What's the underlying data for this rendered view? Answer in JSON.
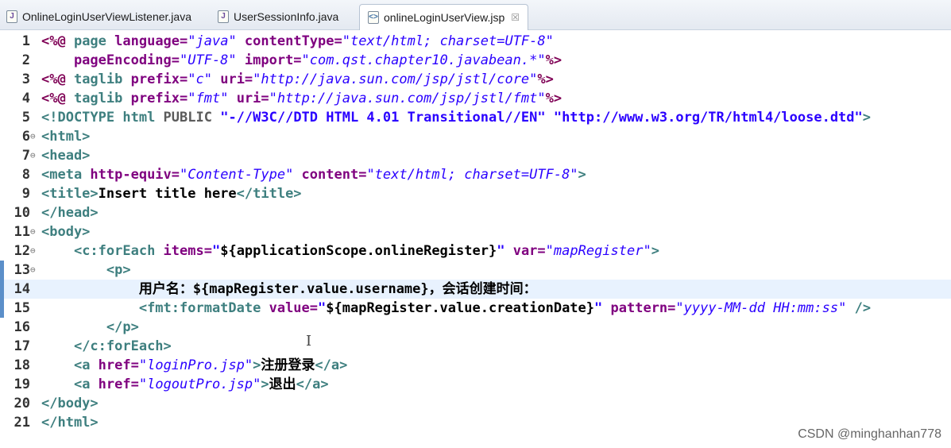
{
  "tabs": [
    {
      "label": "OnlineLoginUserViewListener.java",
      "icon": "java-file-icon"
    },
    {
      "label": "UserSessionInfo.java",
      "icon": "java-file-icon"
    },
    {
      "label": "onlineLoginUserView.jsp",
      "icon": "jsp-file-icon",
      "close": "☒"
    }
  ],
  "lines": [
    {
      "n": "1",
      "fold": "",
      "segs": [
        [
          "jk",
          "<%@ "
        ],
        [
          "tg",
          "page "
        ],
        [
          "at",
          "language="
        ],
        [
          "iv",
          "\"java\""
        ],
        [
          "at",
          " contentType="
        ],
        [
          "iv",
          "\"text/html; charset=UTF-8\""
        ]
      ]
    },
    {
      "n": "2",
      "fold": "",
      "segs": [
        [
          "at",
          "    pageEncoding="
        ],
        [
          "iv",
          "\"UTF-8\""
        ],
        [
          "at",
          " import="
        ],
        [
          "iv",
          "\"com.qst.chapter10.javabean.*\""
        ],
        [
          "jk",
          "%>"
        ]
      ]
    },
    {
      "n": "3",
      "fold": "",
      "segs": [
        [
          "jk",
          "<%@ "
        ],
        [
          "tg",
          "taglib "
        ],
        [
          "at",
          "prefix="
        ],
        [
          "iv",
          "\"c\""
        ],
        [
          "at",
          " uri="
        ],
        [
          "iv",
          "\"http://java.sun.com/jsp/jstl/core\""
        ],
        [
          "jk",
          "%>"
        ]
      ]
    },
    {
      "n": "4",
      "fold": "",
      "segs": [
        [
          "jk",
          "<%@ "
        ],
        [
          "tg",
          "taglib "
        ],
        [
          "at",
          "prefix="
        ],
        [
          "iv",
          "\"fmt\""
        ],
        [
          "at",
          " uri="
        ],
        [
          "iv",
          "\"http://java.sun.com/jsp/jstl/fmt\""
        ],
        [
          "jk",
          "%>"
        ]
      ]
    },
    {
      "n": "5",
      "fold": "",
      "segs": [
        [
          "tg",
          "<!DOCTYPE "
        ],
        [
          "tg",
          "html "
        ],
        [
          "dt",
          "PUBLIC "
        ],
        [
          "sv",
          "\"-//W3C//DTD HTML 4.01 Transitional//EN\" \"http://www.w3.org/TR/html4/loose.dtd\""
        ],
        [
          "tg",
          ">"
        ]
      ]
    },
    {
      "n": "6",
      "fold": "⊖",
      "segs": [
        [
          "tg",
          "<html>"
        ]
      ]
    },
    {
      "n": "7",
      "fold": "⊖",
      "segs": [
        [
          "tg",
          "<head>"
        ]
      ]
    },
    {
      "n": "8",
      "fold": "",
      "segs": [
        [
          "tg",
          "<meta "
        ],
        [
          "at",
          "http-equiv="
        ],
        [
          "iv",
          "\"Content-Type\""
        ],
        [
          "at",
          " content="
        ],
        [
          "iv",
          "\"text/html; charset=UTF-8\""
        ],
        [
          "tg",
          ">"
        ]
      ]
    },
    {
      "n": "9",
      "fold": "",
      "segs": [
        [
          "tg",
          "<title>"
        ],
        [
          "",
          "Insert title here"
        ],
        [
          "tg",
          "</title>"
        ]
      ]
    },
    {
      "n": "10",
      "fold": "",
      "segs": [
        [
          "tg",
          "</head>"
        ]
      ]
    },
    {
      "n": "11",
      "fold": "⊖",
      "segs": [
        [
          "tg",
          "<body>"
        ]
      ]
    },
    {
      "n": "12",
      "fold": "⊖",
      "segs": [
        [
          "",
          "    "
        ],
        [
          "tg",
          "<c:forEach "
        ],
        [
          "at",
          "items="
        ],
        [
          "sv",
          "\""
        ],
        [
          "",
          "${applicationScope.onlineRegister}"
        ],
        [
          "sv",
          "\""
        ],
        [
          "at",
          " var="
        ],
        [
          "iv",
          "\"mapRegister\""
        ],
        [
          "tg",
          ">"
        ]
      ]
    },
    {
      "n": "13",
      "fold": "⊖",
      "segs": [
        [
          "",
          "        "
        ],
        [
          "tg",
          "<p>"
        ]
      ]
    },
    {
      "n": "14",
      "fold": "",
      "current": true,
      "segs": [
        [
          "",
          "            用户名：${mapRegister.value.username}，会话创建时间："
        ]
      ]
    },
    {
      "n": "15",
      "fold": "",
      "segs": [
        [
          "",
          "            "
        ],
        [
          "tg",
          "<fmt:formatDate "
        ],
        [
          "at",
          "value="
        ],
        [
          "sv",
          "\""
        ],
        [
          "",
          "${mapRegister.value.creationDate}"
        ],
        [
          "sv",
          "\""
        ],
        [
          "at",
          " pattern="
        ],
        [
          "iv",
          "\"yyyy-MM-dd HH:mm:ss\""
        ],
        [
          "tg",
          " />"
        ]
      ]
    },
    {
      "n": "16",
      "fold": "",
      "segs": [
        [
          "",
          "        "
        ],
        [
          "tg",
          "</p>"
        ]
      ]
    },
    {
      "n": "17",
      "fold": "",
      "segs": [
        [
          "",
          "    "
        ],
        [
          "tg",
          "</c:forEach>"
        ]
      ]
    },
    {
      "n": "18",
      "fold": "",
      "segs": [
        [
          "",
          "    "
        ],
        [
          "tg",
          "<a "
        ],
        [
          "at",
          "href="
        ],
        [
          "iv",
          "\"loginPro.jsp\""
        ],
        [
          "tg",
          ">"
        ],
        [
          "",
          "注册登录"
        ],
        [
          "tg",
          "</a>"
        ]
      ]
    },
    {
      "n": "19",
      "fold": "",
      "segs": [
        [
          "",
          "    "
        ],
        [
          "tg",
          "<a "
        ],
        [
          "at",
          "href="
        ],
        [
          "iv",
          "\"logoutPro.jsp\""
        ],
        [
          "tg",
          ">"
        ],
        [
          "",
          "退出"
        ],
        [
          "tg",
          "</a>"
        ]
      ]
    },
    {
      "n": "20",
      "fold": "",
      "segs": [
        [
          "tg",
          "</body>"
        ]
      ]
    },
    {
      "n": "21",
      "fold": "",
      "segs": [
        [
          "tg",
          "</html>"
        ]
      ]
    }
  ],
  "cursor_glyph": "I",
  "watermark": "CSDN @minghanhan778"
}
